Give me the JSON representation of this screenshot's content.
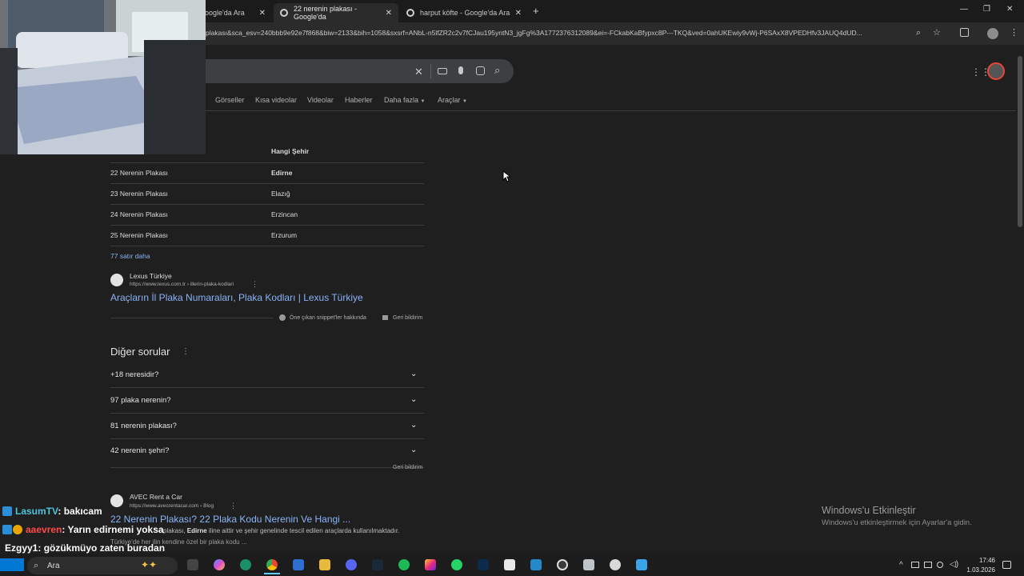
{
  "browser": {
    "tabs": [
      {
        "label": "oogle'da Ara"
      },
      {
        "label": "22 nerenin plakası - Google'da"
      },
      {
        "label": "harput köfte - Google'da Ara"
      }
    ],
    "url": "plakası&sca_esv=240bbb9e92e7f868&biw=2133&bih=1058&sxsrf=ANbL-n5lfZR2c2v7fCJau195yntN3_jgFg%3A1772376312089&ei=-FCkabKaBfypxc8P---TKQ&ved=0ahUKEwiy9vWj-P6SAxX8VPEDHfv3JAUQ4dUD..."
  },
  "search_nav": [
    "Görseller",
    "Kısa videolar",
    "Videolar",
    "Haberler",
    "Daha fazla",
    "Araçlar"
  ],
  "table": {
    "header": "Hangi Şehir",
    "rows": [
      {
        "plate": "22 Nerenin Plakası",
        "city": "Edirne"
      },
      {
        "plate": "23 Nerenin Plakası",
        "city": "Elazığ"
      },
      {
        "plate": "24 Nerenin Plakası",
        "city": "Erzincan"
      },
      {
        "plate": "25 Nerenin Plakası",
        "city": "Erzurum"
      }
    ],
    "more": "77 satır daha"
  },
  "result1": {
    "site": "Lexus Türkiye",
    "url": "https://www.lexus.com.tr › illerin-plaka-kodlari",
    "title": "Araçların İl Plaka Numaraları, Plaka Kodları | Lexus Türkiye",
    "about": "Öne çıkan snippet'ler hakkında",
    "feedback": "Geri bildirim"
  },
  "other_questions": {
    "title": "Diğer sorular",
    "items": [
      "+18 neresidir?",
      "97 plaka nerenin?",
      "81 nerenin plakası?",
      "42 nerenin şehri?"
    ],
    "feedback": "Geri bildirim"
  },
  "result2": {
    "site": "AVEC Rent a Car",
    "url": "https://www.avecrentacar.com › Blog",
    "title": "22 Nerenin Plakası? 22 Plaka Kodu Nerenin Ve Hangi ...",
    "snippet_prefix": "plakası, ",
    "snippet_bold": "Edirne",
    "snippet_rest": " iline aittir ve şehir genelinde tescil edilen araçlarda kullanılmaktadır.",
    "snippet2": "Türkiye'de her ilin kendine özel bir plaka kodu ..."
  },
  "chat": [
    {
      "user": "LasumTV",
      "msg": ": bakıcam",
      "color": "#4fc3d9"
    },
    {
      "user": "aaevren",
      "msg": ": Yarın edirnemi yoksa",
      "color": "#ff4a4a"
    },
    {
      "user": "Ezgyy1",
      "msg": ": gözükmüyo zaten buradan",
      "color": "#ffffff"
    }
  ],
  "watermark": {
    "title": "Windows'u Etkinleştir",
    "subtitle": "Windows'u etkinleştirmek için Ayarlar'a gidin."
  },
  "taskbar": {
    "search": "Ara",
    "time": "17:46",
    "date": "1.03.2026"
  }
}
